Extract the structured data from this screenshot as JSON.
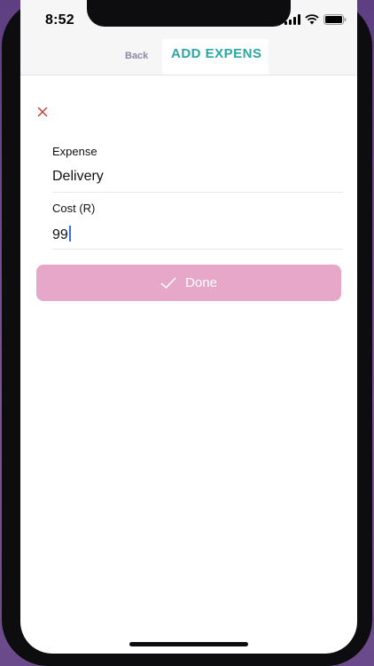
{
  "status_bar": {
    "time": "8:52",
    "icons": [
      "signal-icon",
      "wifi-icon",
      "battery-icon"
    ]
  },
  "nav": {
    "back_label": "Back",
    "title": "ADD EXPENS"
  },
  "form": {
    "close_icon": "close-icon",
    "expense_label": "Expense",
    "expense_value": "Delivery",
    "cost_label": "Cost (R)",
    "cost_value": "99"
  },
  "done_button": {
    "label": "Done",
    "icon": "check-icon"
  },
  "colors": {
    "title_teal": "#2aa7a2",
    "done_pink": "#e7a7c9",
    "close_red": "#c0392b",
    "caret_blue": "#2f6cff"
  }
}
